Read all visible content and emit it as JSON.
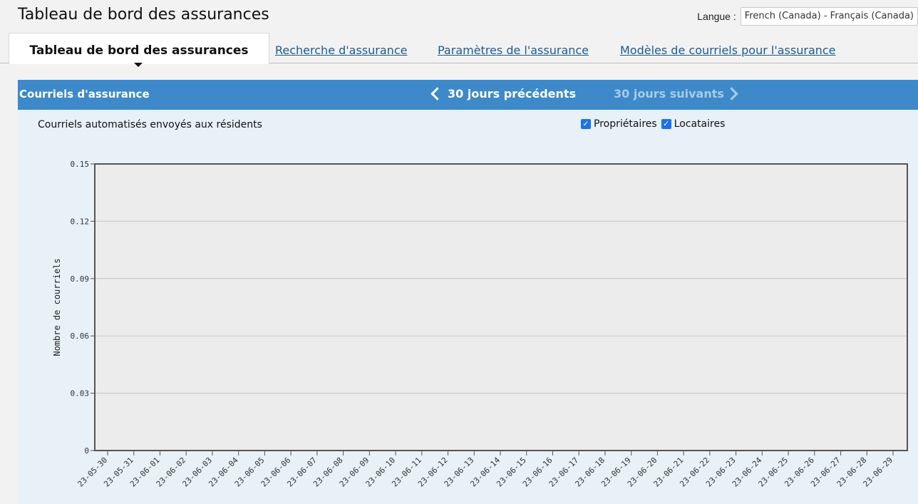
{
  "page": {
    "title": "Tableau de bord des assurances"
  },
  "language": {
    "label": "Langue :",
    "selected": "French (Canada) - Français (Canada)"
  },
  "tabs": [
    {
      "label": "Tableau de bord des assurances",
      "active": true
    },
    {
      "label": "Recherche d'assurance",
      "active": false
    },
    {
      "label": "Paramètres de l'assurance",
      "active": false
    },
    {
      "label": "Modèles de courriels pour l'assurance",
      "active": false
    }
  ],
  "panel": {
    "title": "Courriels d'assurance",
    "prev_label": "30 jours précédents",
    "next_label": "30 jours suivants",
    "subtitle": "Courriels automatisés envoyés aux résidents",
    "filters": [
      {
        "label": "Propriétaires",
        "checked": true
      },
      {
        "label": "Locataires",
        "checked": true
      }
    ]
  },
  "colors": {
    "header_blue": "#3d89c9",
    "panel_bg": "#e8f0f8",
    "plot_bg": "#ececec",
    "link": "#1f5b8f"
  },
  "chart_data": {
    "type": "line",
    "title": "",
    "xlabel": "",
    "ylabel": "Nombre de courriels",
    "ylim": [
      0,
      0.15
    ],
    "yticks": [
      0,
      0.03,
      0.06,
      0.09,
      0.12,
      0.15
    ],
    "ytick_labels": [
      "0",
      "0.03",
      "0.06",
      "0.09",
      "0.12",
      "0.15"
    ],
    "categories": [
      "23-05-30",
      "23-05-31",
      "23-06-01",
      "23-06-02",
      "23-06-03",
      "23-06-04",
      "23-06-05",
      "23-06-06",
      "23-06-07",
      "23-06-08",
      "23-06-09",
      "23-06-10",
      "23-06-11",
      "23-06-12",
      "23-06-13",
      "23-06-14",
      "23-06-15",
      "23-06-16",
      "23-06-17",
      "23-06-18",
      "23-06-19",
      "23-06-20",
      "23-06-21",
      "23-06-22",
      "23-06-23",
      "23-06-24",
      "23-06-25",
      "23-06-26",
      "23-06-27",
      "23-06-28",
      "23-06-29"
    ],
    "series": [],
    "grid": true
  }
}
